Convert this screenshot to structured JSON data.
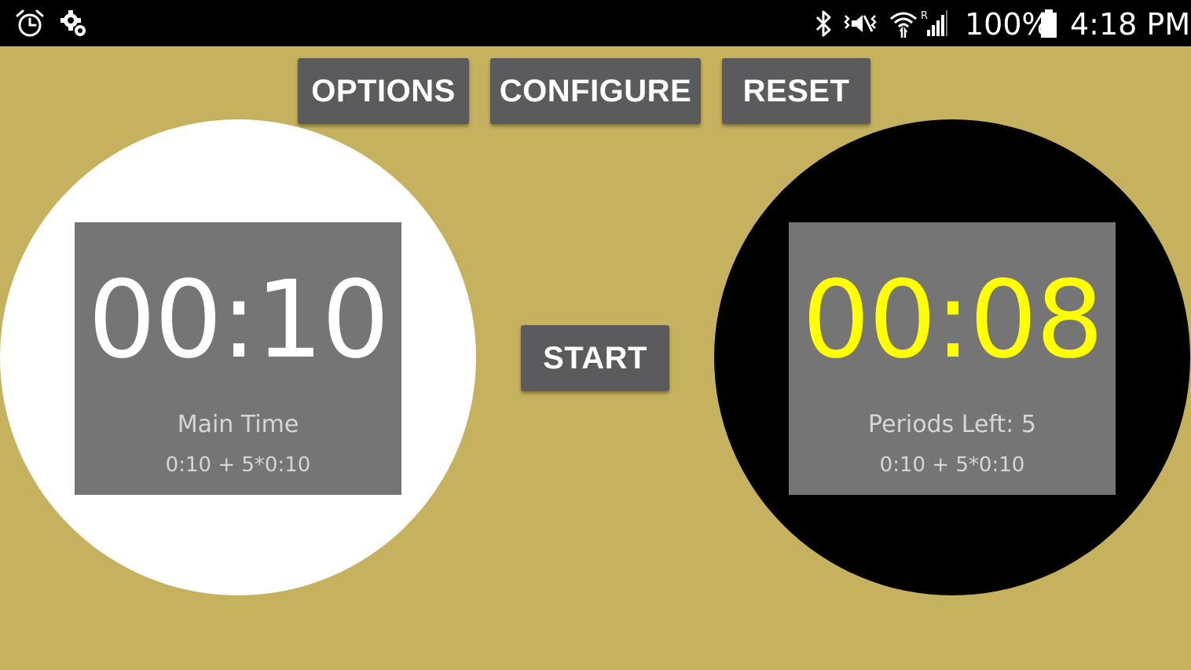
{
  "status_bar": {
    "left_icons": [
      "alarm-clock-icon",
      "settings-gear-icon"
    ],
    "right_icons": [
      "bluetooth-icon",
      "vibrate-mute-icon",
      "wifi-icon",
      "cellular-signal-icon",
      "battery-icon"
    ],
    "battery_percent": "100%",
    "time": "4:18 PM"
  },
  "toolbar": {
    "options_label": "OPTIONS",
    "configure_label": "CONFIGURE",
    "reset_label": "RESET"
  },
  "start_label": "START",
  "left_clock": {
    "time": "00:10",
    "label": "Main Time",
    "settings": "0:10 + 5*0:10",
    "circle_color": "#ffffff",
    "time_color": "#ffffff"
  },
  "right_clock": {
    "time": "00:08",
    "label": "Periods Left: 5",
    "settings": "0:10 + 5*0:10",
    "circle_color": "#000000",
    "time_color": "#ffff00"
  },
  "colors": {
    "background": "#c6b25e",
    "button": "#5b5b5e",
    "panel": "#757575",
    "status_bar": "#000000"
  }
}
